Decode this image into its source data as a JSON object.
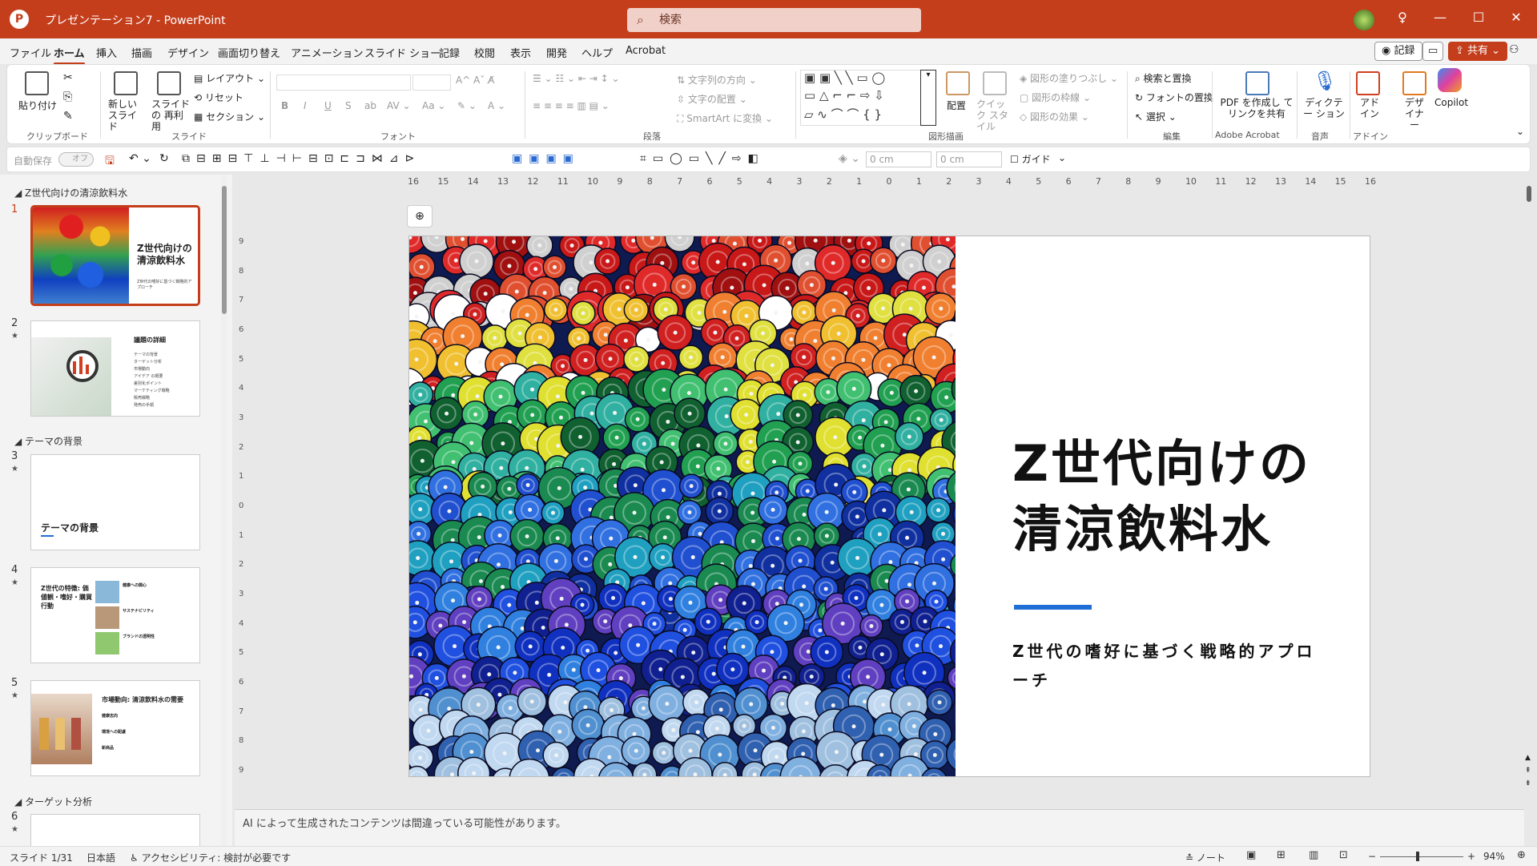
{
  "window": {
    "app_icon": "P",
    "title": "プレゼンテーション7 - PowerPoint",
    "search_placeholder": "検索"
  },
  "menu": {
    "tabs": [
      "ファイル",
      "ホーム",
      "挿入",
      "描画",
      "デザイン",
      "画面切り替え",
      "アニメーション",
      "スライド ショー",
      "記録",
      "校閲",
      "表示",
      "開発",
      "ヘルプ",
      "Acrobat"
    ],
    "active_tab": "ホーム",
    "record_button": "記録",
    "share_button": "共有"
  },
  "ribbon": {
    "clipboard": {
      "paste": "貼り付け",
      "group": "クリップボード"
    },
    "slides": {
      "new_slide": "新しい スライド",
      "reuse": "スライドの 再利用",
      "layout": "レイアウト",
      "reset": "リセット",
      "section": "セクション",
      "group": "スライド"
    },
    "font": {
      "group": "フォント"
    },
    "paragraph": {
      "text_direction": "文字列の方向",
      "align_text": "文字の配置",
      "smartart": "SmartArt に変換",
      "group": "段落"
    },
    "drawing": {
      "arrange": "配置",
      "quick_styles": "クイック スタイル",
      "shape_fill": "図形の塗りつぶし",
      "shape_outline": "図形の枠線",
      "shape_effects": "図形の効果",
      "group": "図形描画"
    },
    "editing": {
      "find_replace": "検索と置換",
      "replace_font": "フォントの置換",
      "select": "選択",
      "group": "編集"
    },
    "acrobat": {
      "create_pdf": "PDF を作成し てリンクを共有",
      "group": "Adobe Acrobat"
    },
    "voice": {
      "dictate": "ディクテー ション",
      "group": "音声"
    },
    "addins": {
      "addins": "アド イン",
      "group": "アドイン"
    },
    "designer": {
      "label": "デザ イナー"
    },
    "copilot": {
      "label": "Copilot"
    }
  },
  "qat": {
    "autosave": "自動保存",
    "autosave_state": "オフ",
    "width_value": "0 cm",
    "height_value": "0 cm",
    "guide": "ガイド"
  },
  "slide_panel": {
    "sections": [
      {
        "name": "Z世代向けの清涼飲料水"
      },
      {
        "name": "テーマの背景"
      },
      {
        "name": "ターゲット分析"
      }
    ],
    "slides": [
      {
        "num": "1",
        "title": "Z世代向けの 清涼飲料水",
        "sub": "Z世代の嗜好に基づく戦略的アプローチ"
      },
      {
        "num": "2",
        "title": "議題の詳細",
        "items": [
          "テーマの背景",
          "ターゲット分析",
          "市場動向",
          "アイデア の概要",
          "差別化ポイント",
          "マーケティング戦略",
          "販売戦略",
          "発売の手順"
        ]
      },
      {
        "num": "3",
        "title": "テーマの背景"
      },
      {
        "num": "4",
        "title": "Z世代の特徴: 価値観・嗜好・購買行動",
        "sub1": "健康への関心",
        "sub2": "サステナビリティ",
        "sub3": "ブランドの透明性"
      },
      {
        "num": "5",
        "title": "市場動向: 清涼飲料水の需要",
        "sub1": "健康志向",
        "sub2": "環境への配慮",
        "sub3": "新商品"
      },
      {
        "num": "6",
        "title": ""
      }
    ]
  },
  "main_slide": {
    "title_line1": "Z世代向けの",
    "title_line2": "清涼飲料水",
    "subtitle": "Z世代の嗜好に基づく戦略的アプローチ",
    "accent_color": "#1f6fd6"
  },
  "rulers": {
    "horizontal": [
      "16",
      "15",
      "14",
      "13",
      "12",
      "11",
      "10",
      "9",
      "8",
      "7",
      "6",
      "5",
      "4",
      "3",
      "2",
      "1",
      "0",
      "1",
      "2",
      "3",
      "4",
      "5",
      "6",
      "7",
      "8",
      "9",
      "10",
      "11",
      "12",
      "13",
      "14",
      "15",
      "16"
    ],
    "vertical": [
      "9",
      "8",
      "7",
      "6",
      "5",
      "4",
      "3",
      "2",
      "1",
      "0",
      "1",
      "2",
      "3",
      "4",
      "5",
      "6",
      "7",
      "8",
      "9"
    ]
  },
  "notes": {
    "text": "AI によって生成されたコンテンツは間違っている可能性があります。"
  },
  "status": {
    "slide_counter": "スライド 1/31",
    "language": "日本語",
    "accessibility": "アクセシビリティ: 検討が必要です",
    "notes_button": "ノート",
    "zoom": "94%"
  },
  "colors": {
    "brand": "#c43e1c",
    "accent_blue": "#1f6fd6"
  }
}
